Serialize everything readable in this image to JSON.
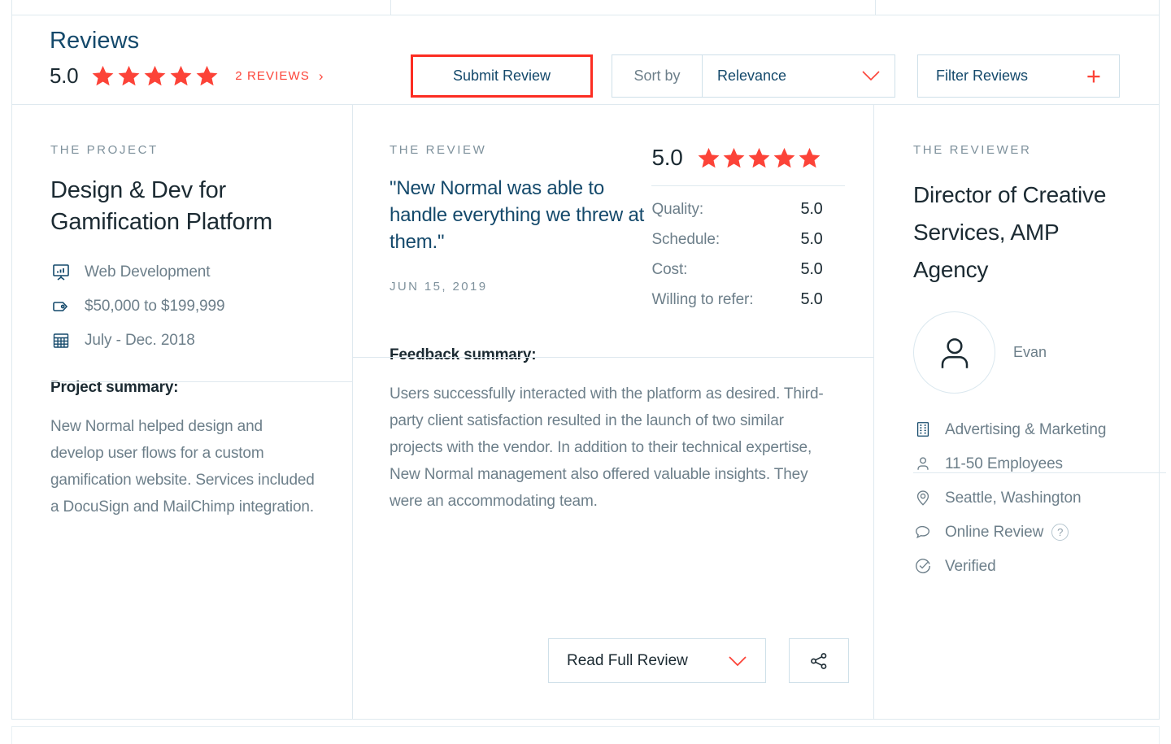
{
  "header": {
    "title": "Reviews",
    "rating": "5.0",
    "stars": 5,
    "reviews_link": "2 REVIEWS",
    "chevron": "›",
    "submit_label": "Submit Review",
    "sort_label": "Sort by",
    "sort_value": "Relevance",
    "filter_label": "Filter Reviews",
    "plus": "+"
  },
  "project": {
    "eyebrow": "THE PROJECT",
    "title": "Design & Dev for Gamification Platform",
    "meta": [
      {
        "icon": "presentation-chart-icon",
        "text": "Web Development"
      },
      {
        "icon": "price-tag-icon",
        "text": "$50,000 to $199,999"
      },
      {
        "icon": "calendar-icon",
        "text": "July - Dec. 2018"
      }
    ],
    "summary_heading": "Project summary:",
    "summary_text": "New Normal helped design and develop user flows for a custom gamification website. Services included a DocuSign and MailChimp integration."
  },
  "review": {
    "eyebrow": "THE REVIEW",
    "quote": "\"New Normal was able to handle everything we threw at them.\"",
    "date": "JUN 15, 2019",
    "score": "5.0",
    "stars": 5,
    "scores": [
      {
        "label": "Quality:",
        "value": "5.0"
      },
      {
        "label": "Schedule:",
        "value": "5.0"
      },
      {
        "label": "Cost:",
        "value": "5.0"
      },
      {
        "label": "Willing to refer:",
        "value": "5.0"
      }
    ],
    "feedback_heading": "Feedback summary:",
    "feedback_text": "Users successfully interacted with the platform as desired. Third-party client satisfaction resulted in the launch of two similar projects with the vendor. In addition to their technical expertise, New Normal management also offered valuable insights. They were an accommodating team.",
    "read_label": "Read Full Review",
    "share_icon": "share-icon"
  },
  "reviewer": {
    "eyebrow": "THE REVIEWER",
    "title": "Director of Creative Services, AMP Agency",
    "avatar_name": "Evan",
    "facts": [
      {
        "icon": "building-icon",
        "text": "Advertising & Marketing",
        "help": null
      },
      {
        "icon": "person-icon",
        "text": "11-50 Employees",
        "help": null
      },
      {
        "icon": "location-pin-icon",
        "text": "Seattle, Washington",
        "help": null
      },
      {
        "icon": "speech-bubble-icon",
        "text": "Online Review",
        "help": "?"
      },
      {
        "icon": "check-circle-icon",
        "text": "Verified",
        "help": null
      }
    ]
  },
  "colors": {
    "accent_red": "#fc4338",
    "highlight_red": "#fc2d22",
    "brand_navy": "#14496b",
    "dark_text": "#1b2a32",
    "muted_text": "#6d7f8a",
    "eyebrow_text": "#7e919c",
    "border": "#dfe9ef",
    "button_border": "#cfe0e9"
  }
}
